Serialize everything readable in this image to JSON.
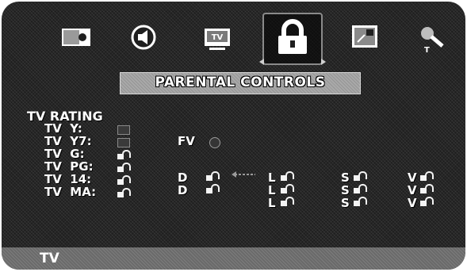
{
  "menu": {
    "icons": [
      "picture-icon",
      "sound-icon",
      "tv-icon",
      "lock-icon",
      "screen-icon",
      "setup-icon"
    ],
    "tv_icon_text": "TV",
    "setup_icon_text": "T"
  },
  "title": "PARENTAL CONTROLS",
  "tv_rating": {
    "heading": "TV RATING",
    "rows": [
      {
        "label": "TV  Y:"
      },
      {
        "label": "TV  Y7:",
        "extra_label": "FV"
      },
      {
        "label": "TV  G:"
      },
      {
        "label": "TV  PG:",
        "sub": [
          "D",
          "L",
          "S",
          "V"
        ]
      },
      {
        "label": "TV  14:",
        "sub": [
          "D",
          "L",
          "S",
          "V"
        ]
      },
      {
        "label": "TV  MA:",
        "sub": [
          "L",
          "S",
          "V"
        ]
      }
    ]
  },
  "bottom_bar": {
    "label": "TV"
  },
  "colors": {
    "background": "#1f1f1f",
    "title_box": "#a9a9a9",
    "text": "#ffffff",
    "bottom_bar": "#6a6a6a"
  }
}
